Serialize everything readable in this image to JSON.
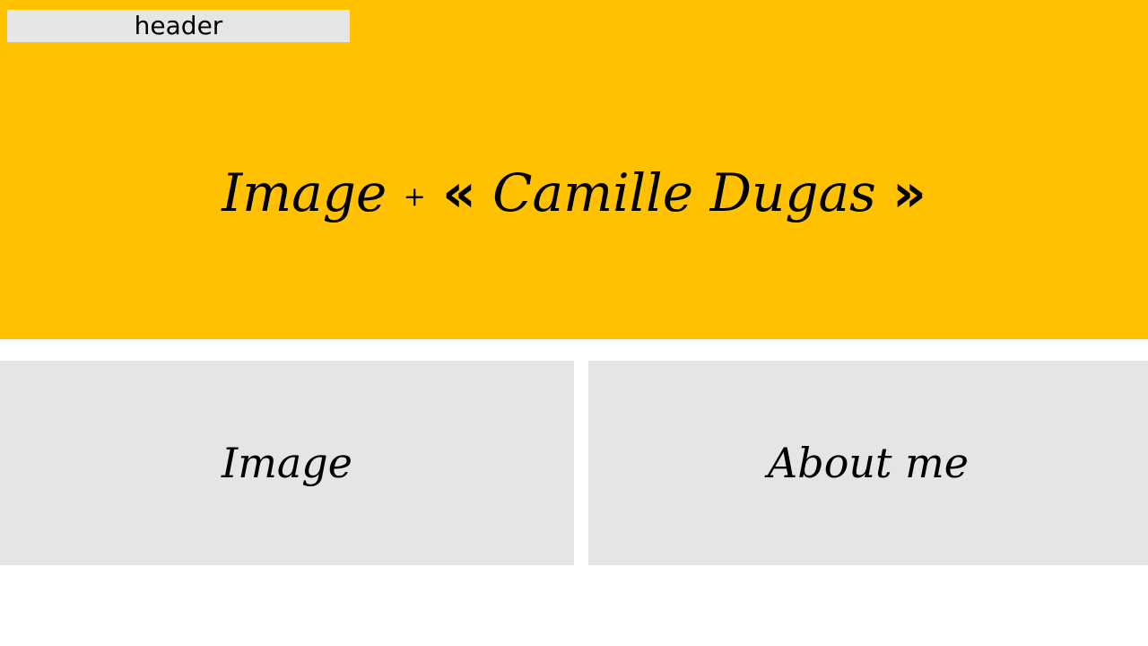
{
  "header": {
    "label": "header"
  },
  "hero": {
    "prefix": "Image",
    "plus": "+",
    "open_quote": "«",
    "name": "Camille Dugas",
    "close_quote": "»",
    "background_color": "#ffc100"
  },
  "cards": {
    "image_label": "Image",
    "about_label": "About me",
    "background_color": "#e5e5e5"
  }
}
